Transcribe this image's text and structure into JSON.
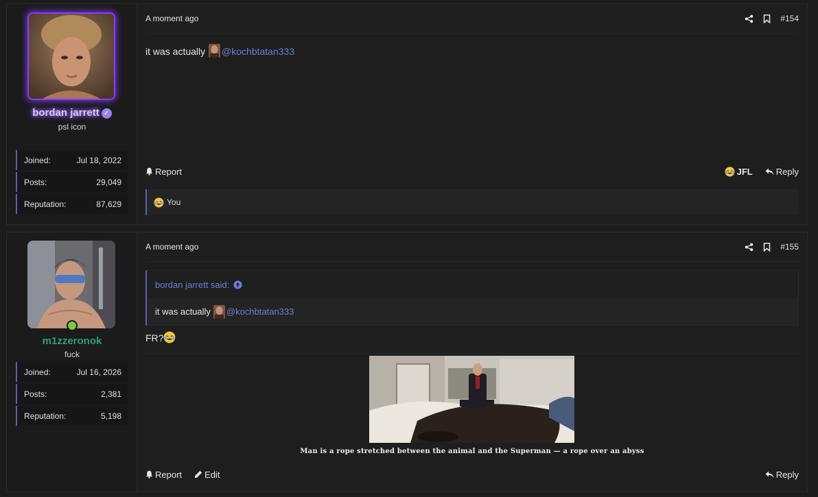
{
  "posts": [
    {
      "user": {
        "name": "bordan jarrett",
        "title": "psl icon",
        "verified": true,
        "name_color": "#d6c3ff",
        "avatar_border_color": "#8a3bff",
        "stats": [
          {
            "label": "Joined:",
            "value": "Jul 18, 2022"
          },
          {
            "label": "Posts:",
            "value": "29,049"
          },
          {
            "label": "Reputation:",
            "value": "87,629"
          }
        ]
      },
      "time": "A moment ago",
      "number": "#154",
      "body": {
        "prefix": "it was actually",
        "mention": "@kochbtatan333"
      },
      "actions": {
        "report": "Report",
        "reaction": "JFL",
        "reply": "Reply"
      },
      "reactions_summary": "You"
    },
    {
      "user": {
        "name": "m1zzeronok",
        "title": "fuck",
        "online": true,
        "name_color": "#2ea078",
        "stats": [
          {
            "label": "Joined:",
            "value": "Jul 16, 2026"
          },
          {
            "label": "Posts:",
            "value": "2,381"
          },
          {
            "label": "Reputation:",
            "value": "5,198"
          }
        ]
      },
      "time": "A moment ago",
      "number": "#155",
      "quote": {
        "author_said": "bordan jarrett said:",
        "prefix": "it was actually",
        "mention": "@kochbtatan333"
      },
      "body_text": "FR?",
      "caption": "Man is a rope stretched between the animal and the Superman — a rope over an abyss",
      "actions": {
        "report": "Report",
        "edit": "Edit",
        "reply": "Reply"
      }
    }
  ],
  "colors": {
    "accent": "#5563b5",
    "mention": "#6f7fd6",
    "online": "#7ac943",
    "background": "#1c1c1c"
  },
  "icons": [
    "share-icon",
    "bookmark-icon",
    "bell-icon",
    "pencil-icon",
    "reply-arrow-icon",
    "arrow-up-circle-icon",
    "laughing-crying-emoji",
    "check-badge-icon"
  ]
}
